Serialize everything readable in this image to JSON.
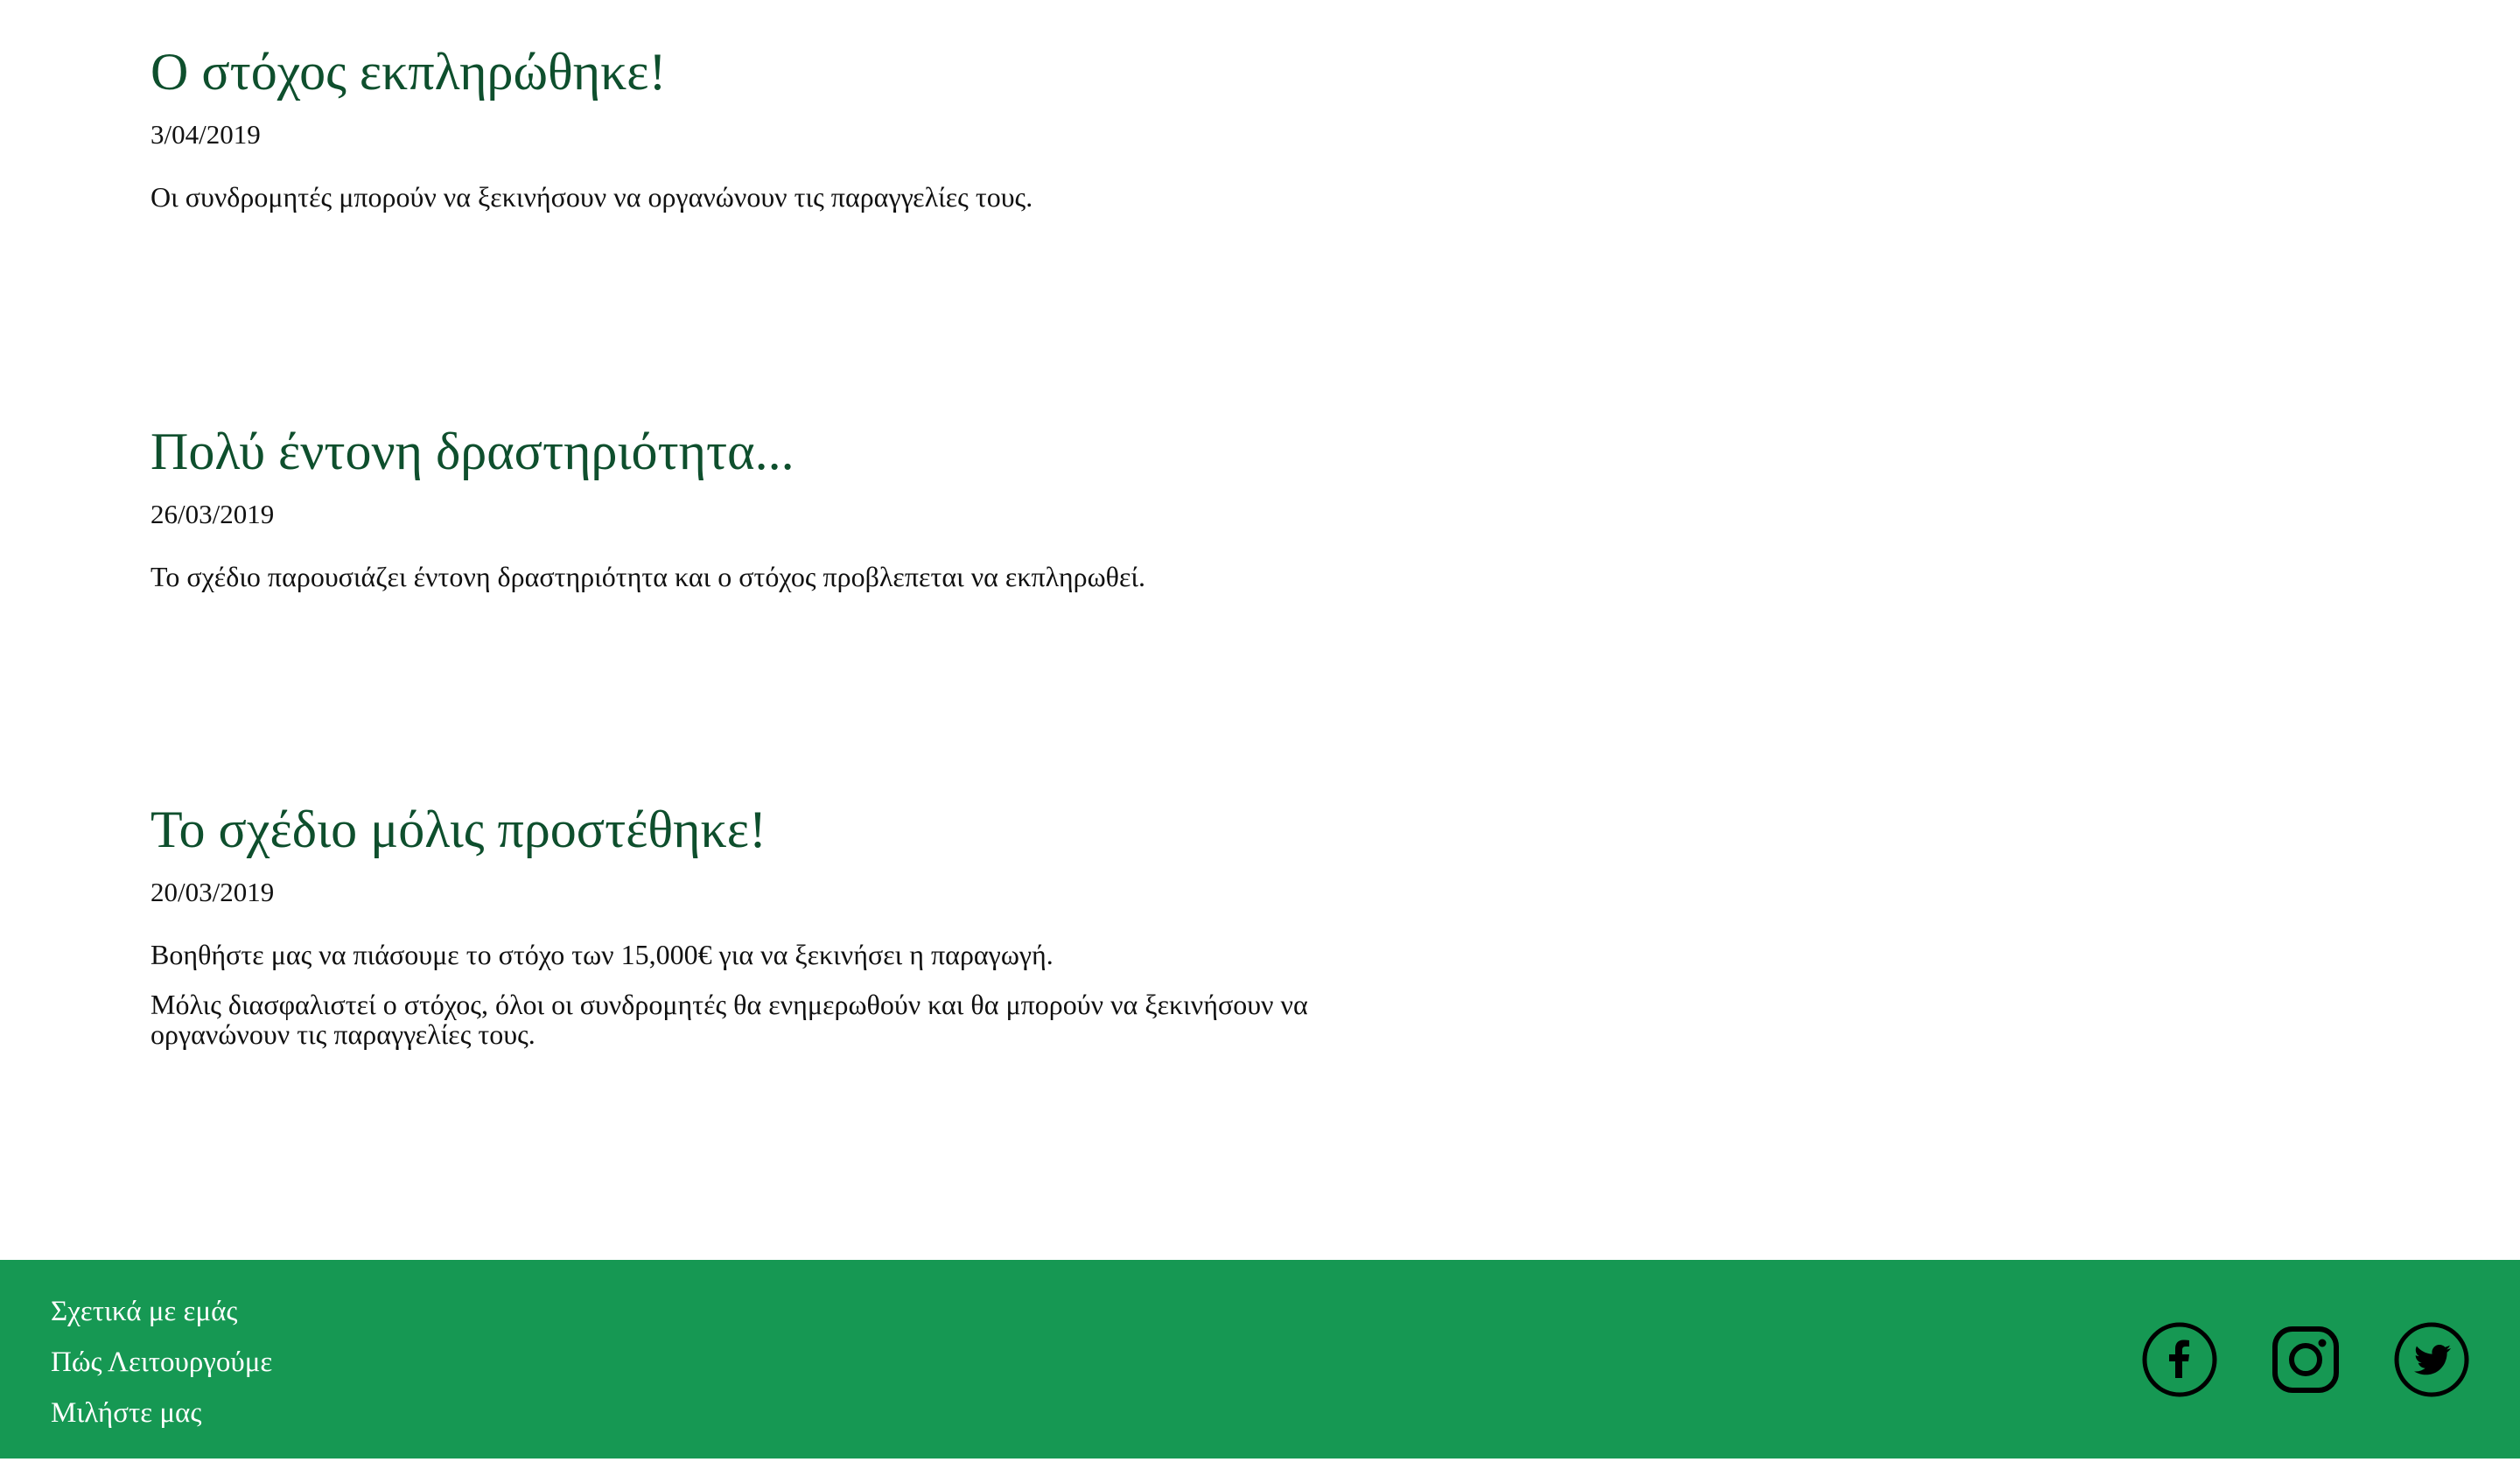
{
  "updates": [
    {
      "title": "Ο στόχος εκπληρώθηκε!",
      "date": "3/04/2019",
      "paragraphs": [
        "Οι συνδρομητές μπορούν να ξεκινήσουν να οργανώνουν τις παραγγελίες τους."
      ]
    },
    {
      "title": "Πολύ έντονη δραστηριότητα...",
      "date": "26/03/2019",
      "paragraphs": [
        "Το σχέδιο παρουσιάζει έντονη δραστηριότητα και ο στόχος προβλεπεται να εκπληρωθεί."
      ]
    },
    {
      "title": "Το σχέδιο μόλις προστέθηκε!",
      "date": "20/03/2019",
      "paragraphs": [
        "Βοηθήστε μας να πιάσουμε το στόχο των 15,000€ για να ξεκινήσει η παραγωγή.",
        "Μόλις διασφαλιστεί ο στόχος, όλοι οι συνδρομητές θα ενημερωθούν και θα μπορούν να ξεκινήσουν να οργανώνουν τις παραγγελίες τους."
      ]
    }
  ],
  "footer": {
    "links": [
      "Σχετικά με εμάς",
      "Πώς Λειτουργούμε",
      "Μιλήστε μας"
    ],
    "social_icons": [
      "facebook-icon",
      "instagram-icon",
      "twitter-icon"
    ]
  },
  "colors": {
    "title_green": "#0e4f2d",
    "footer_green": "#169853",
    "icon_black": "#000000",
    "link_white": "#ffffff"
  }
}
